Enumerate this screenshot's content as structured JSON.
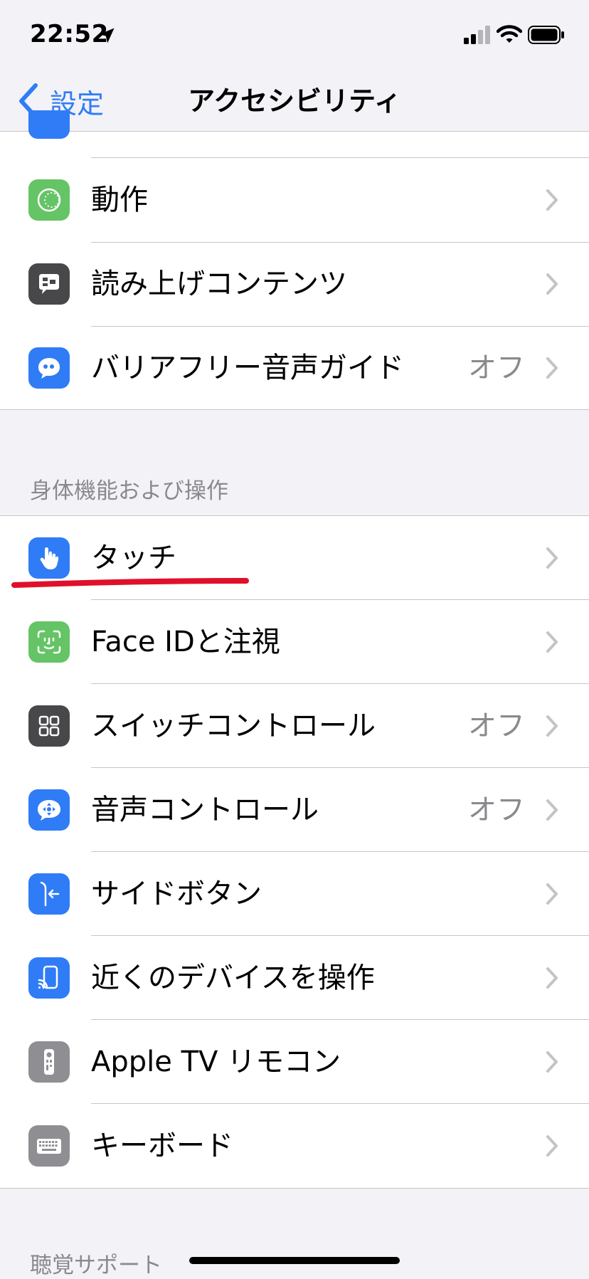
{
  "status_bar": {
    "time": "22:52"
  },
  "nav": {
    "back_label": "設定",
    "title": "アクセシビリティ"
  },
  "groups": {
    "top": [
      {
        "label": "動作",
        "value": "",
        "icon": "motion-icon",
        "color": "#65c466"
      },
      {
        "label": "読み上げコンテンツ",
        "value": "",
        "icon": "spoken-content-icon",
        "color": "#48484a"
      },
      {
        "label": "バリアフリー音声ガイド",
        "value": "オフ",
        "icon": "audio-description-icon",
        "color": "#2f7cf6"
      }
    ],
    "physical": {
      "header": "身体機能および操作",
      "items": [
        {
          "label": "タッチ",
          "value": "",
          "icon": "touch-hand-icon",
          "color": "#2f7cf6"
        },
        {
          "label": "Face IDと注視",
          "value": "",
          "icon": "face-id-icon",
          "color": "#65c466"
        },
        {
          "label": "スイッチコントロール",
          "value": "オフ",
          "icon": "switch-control-icon",
          "color": "#48484a"
        },
        {
          "label": "音声コントロール",
          "value": "オフ",
          "icon": "voice-control-icon",
          "color": "#2f7cf6"
        },
        {
          "label": "サイドボタン",
          "value": "",
          "icon": "side-button-icon",
          "color": "#2f7cf6"
        },
        {
          "label": "近くのデバイスを操作",
          "value": "",
          "icon": "nearby-devices-icon",
          "color": "#2f7cf6"
        },
        {
          "label": "Apple TV リモコン",
          "value": "",
          "icon": "tv-remote-icon",
          "color": "#8e8e93"
        },
        {
          "label": "キーボード",
          "value": "",
          "icon": "keyboard-icon",
          "color": "#8e8e93"
        }
      ]
    },
    "hearing": {
      "header": "聴覚サポート"
    }
  },
  "colors": {
    "accent": "#2f7cf6",
    "annotation": "#e0102a",
    "background": "#f2f2f7"
  }
}
